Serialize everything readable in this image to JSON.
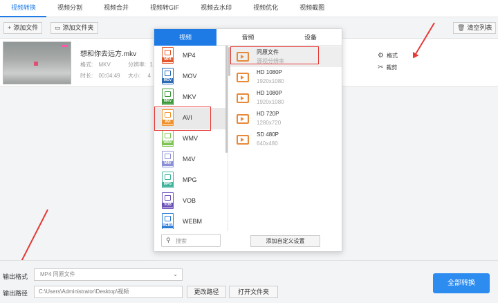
{
  "tabs": [
    "视频转换",
    "视频分割",
    "视频合并",
    "视频转GIF",
    "视频去水印",
    "视频优化",
    "视频截图"
  ],
  "active_tab": "视频转换",
  "toolbar": {
    "add_file": "添加文件",
    "add_folder": "添加文件夹",
    "clear_list": "清空列表"
  },
  "file": {
    "name": "想和你去远方.mkv",
    "format_label": "格式:",
    "format_value": "MKV",
    "resolution_label": "分辨率:",
    "resolution_value": "1",
    "duration_label": "时长:",
    "duration_value": "00:04:49",
    "size_label": "大小:",
    "size_value": "4"
  },
  "file_ops": {
    "format": "格式",
    "cut": "裁剪"
  },
  "popup": {
    "tabs": [
      "视频",
      "音频",
      "设备"
    ],
    "formats": [
      {
        "label": "MP4",
        "color": "#e2572b"
      },
      {
        "label": "MOV",
        "color": "#2b6cb5"
      },
      {
        "label": "MKV",
        "color": "#3d9a3a"
      },
      {
        "label": "AVI",
        "color": "#f0922b"
      },
      {
        "label": "WMV",
        "color": "#7dc352"
      },
      {
        "label": "M4V",
        "color": "#8a8fd6"
      },
      {
        "label": "MPG",
        "color": "#3fb39a"
      },
      {
        "label": "VOB",
        "color": "#6b4fb8"
      },
      {
        "label": "WEBM",
        "color": "#2b7bd6"
      }
    ],
    "selected_format": "AVI",
    "resolutions": [
      {
        "name": "同原文件",
        "sub": "源视分辨率"
      },
      {
        "name": "HD 1080P",
        "sub": "1920x1080"
      },
      {
        "name": "HD 1080P",
        "sub": "1920x1080"
      },
      {
        "name": "HD 720P",
        "sub": "1280x720"
      },
      {
        "name": "SD 480P",
        "sub": "640x480"
      }
    ],
    "search_placeholder": "搜索",
    "custom_button": "添加自定义设置"
  },
  "bottom": {
    "output_format_label": "输出格式",
    "output_format_value": "MP4  同原文件",
    "output_path_label": "输出路径",
    "output_path_value": "C:\\Users\\Administrator\\Desktop\\视频",
    "change_path": "更改路径",
    "open_folder": "打开文件夹",
    "convert_all": "全部转换"
  },
  "colors": {
    "accent": "#1e7be6",
    "convert_button": "#2d8cf0",
    "highlight_red": "#e53935",
    "video_icon": "#e8893a"
  }
}
